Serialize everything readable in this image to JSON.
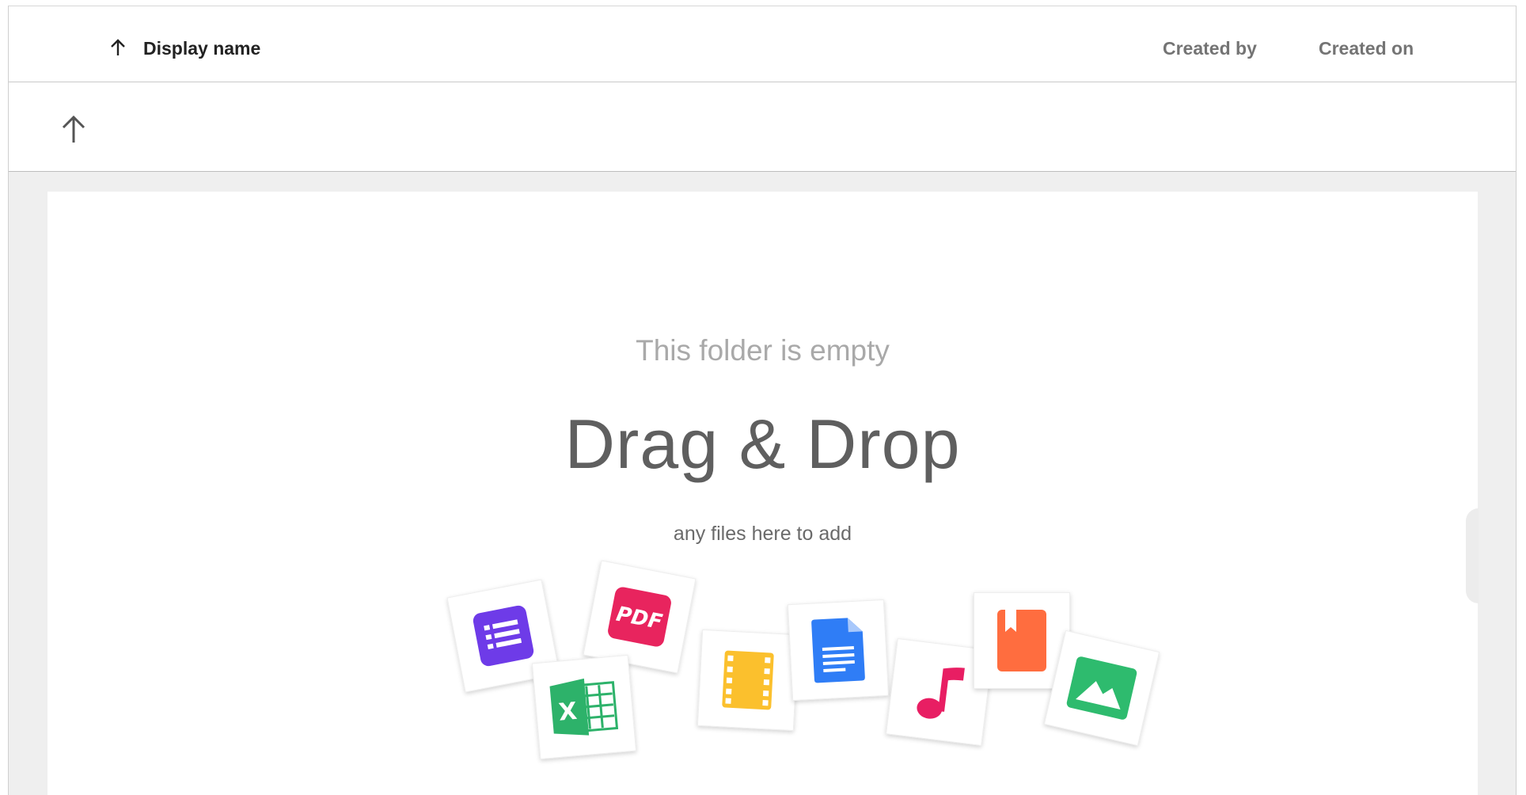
{
  "header": {
    "display_name_label": "Display name",
    "created_by_label": "Created by",
    "created_on_label": "Created on",
    "sort_icon": "arrow-up-icon"
  },
  "navigation": {
    "up_icon": "arrow-up-icon"
  },
  "empty_state": {
    "title": "This folder is empty",
    "headline": "Drag & Drop",
    "subtitle": "any files here to add",
    "file_icons": [
      {
        "name": "list-icon",
        "color": "#6E3BE8"
      },
      {
        "name": "pdf-icon",
        "label": "PDF",
        "color": "#E8245E"
      },
      {
        "name": "excel-icon",
        "label": "X",
        "color": "#2DB26A"
      },
      {
        "name": "film-icon",
        "color": "#FBC02D"
      },
      {
        "name": "document-icon",
        "color": "#2F7DF6"
      },
      {
        "name": "music-note-icon",
        "color": "#E81E63"
      },
      {
        "name": "bookmark-icon",
        "color": "#FF6D3F"
      },
      {
        "name": "image-icon",
        "color": "#2EBB6E"
      }
    ]
  }
}
